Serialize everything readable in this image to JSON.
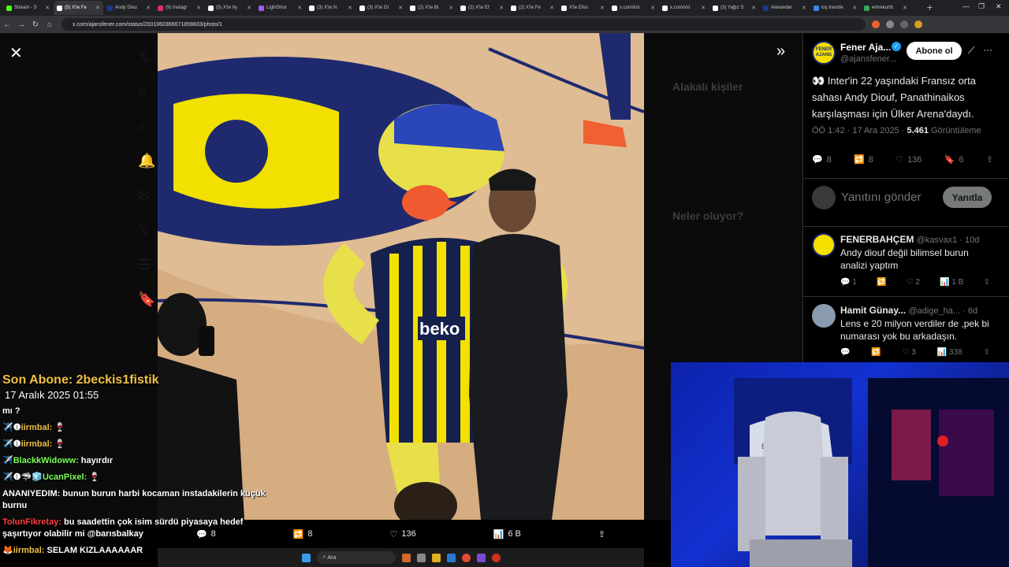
{
  "browser": {
    "tabs": [
      {
        "label": "Stream - S",
        "color": "#53fc18"
      },
      {
        "label": "(5) X'te Fe",
        "color": "#ffffff",
        "active": true
      },
      {
        "label": "Andy Diou",
        "color": "#1a3a8a"
      },
      {
        "label": "(9) Instagr",
        "color": "#e1306c"
      },
      {
        "label": "(5) X'te Ily",
        "color": "#ffffff"
      },
      {
        "label": "LightShot",
        "color": "#a05cf0"
      },
      {
        "label": "(3) X'te N",
        "color": "#ffffff"
      },
      {
        "label": "(3) X'te Gl",
        "color": "#ffffff"
      },
      {
        "label": "(2) X'te Bl",
        "color": "#ffffff"
      },
      {
        "label": "(2) X'te Ef",
        "color": "#ffffff"
      },
      {
        "label": "(2) X'te Fe",
        "color": "#ffffff"
      },
      {
        "label": "X'te Efes",
        "color": "#ffffff"
      },
      {
        "label": "x.com/i/st",
        "color": "#ffffff"
      },
      {
        "label": "x.com/i/st",
        "color": "#ffffff"
      },
      {
        "label": "(3) Yağız S",
        "color": "#ffffff"
      },
      {
        "label": "Alexander",
        "color": "#1a3a8a"
      },
      {
        "label": "loş transfe",
        "color": "#4285f4"
      },
      {
        "label": "emrekurtb",
        "color": "#34a853"
      }
    ],
    "url": "x.com/ajansfener.com/status/2001060366671859833/photo/1"
  },
  "viewer": {
    "likes_bar": {
      "replies": "8",
      "reposts": "8",
      "likes": "136",
      "views": "6 B"
    },
    "dimmed_sidebar": {
      "related_people": "Alakalı kişiler",
      "whats_happening": "Neler oluyor?"
    }
  },
  "tweet": {
    "account_name": "Fener Aja...",
    "handle": "@ajansfener...",
    "avatar_text": "FENER AJANS",
    "subscribe_label": "Abone ol",
    "text": "👀 Inter'in 22 yaşındaki Fransız orta sahası Andy Diouf, Panathinaikos karşılaşması için Ülker Arena'daydı.",
    "time": "ÖÖ 1:42 · 17 Ara 2025 ·",
    "views_count": "5.461",
    "views_label": "Görüntüleme",
    "replies": "8",
    "reposts": "8",
    "likes": "136",
    "bookmarks": "6",
    "reply_placeholder": "Yanıtını gönder",
    "reply_button": "Yanıtla"
  },
  "comments": [
    {
      "name": "FENERBAHÇEM",
      "handle": "@kasvax1 · 10d",
      "text": "Andy diouf değil bilimsel burun analizi yaptım",
      "replies": "1",
      "likes": "2",
      "views": "1 B",
      "avatar_color": "#f5e000"
    },
    {
      "name": "Hamit Günay...",
      "handle": "@adige_ha... · 6d",
      "text": "Lens e 20 milyon verdiler de ,pek bi numarası yok bu arkadaşın.",
      "replies": "",
      "likes": "3",
      "views": "338",
      "avatar_color": "#8a9bb0"
    }
  ],
  "overlay": {
    "last_sub": "Son Abone: 2beckis1fistik",
    "date": "17 Aralık 2025   01:55",
    "chat": [
      {
        "user": "",
        "msg": "mı ?",
        "color": "#ffffff"
      },
      {
        "user": "iirmbal:",
        "msg": "🍷",
        "color": "#f0c040",
        "badge": "✈️❶"
      },
      {
        "user": "iirmbal:",
        "msg": "🍷",
        "color": "#f0c040",
        "badge": "✈️❶"
      },
      {
        "user": "BlackkWidoww:",
        "msg": "hayırdır",
        "color": "#7dff5a",
        "badge": "✈️"
      },
      {
        "user": "UcanPixel:",
        "msg": "🍷",
        "color": "#7dff5a",
        "badge": "✈️❶🦈🧊"
      },
      {
        "user": "ANANIYEDIM:",
        "msg": "bunun burun harbi kocaman instadakilerin küçük burnu",
        "color": "#ffffff",
        "badge": ""
      },
      {
        "user": "TolunFikretay:",
        "msg": "bu saadettin çok isim sürdü piyasaya hedef şaşırtıyor olabilir mi @barısbalkay",
        "color": "#ff4040",
        "badge": ""
      },
      {
        "user": "iirmbal:",
        "msg": "SELAM KIZLAAAAAAR",
        "color": "#f0c040",
        "badge": "🦊"
      }
    ]
  },
  "taskbar": {
    "search_label": "Ara"
  },
  "colors": {
    "accent": "#1d9bf0",
    "bg": "#000000",
    "muted": "#71767b"
  }
}
